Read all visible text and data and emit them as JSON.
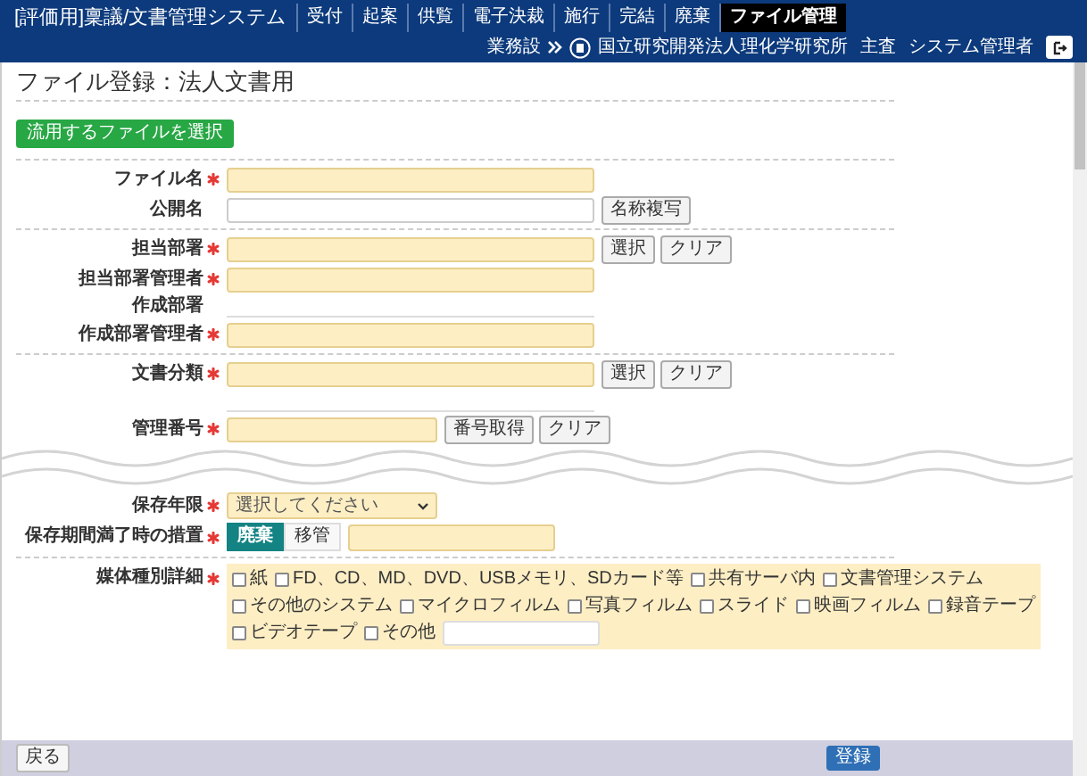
{
  "header": {
    "title": "[評価用]稟議/文書管理システム",
    "nav": [
      {
        "label": "受付",
        "selected": false
      },
      {
        "label": "起案",
        "selected": false
      },
      {
        "label": "供覧",
        "selected": false
      },
      {
        "label": "電子決裁",
        "selected": false
      },
      {
        "label": "施行",
        "selected": false
      },
      {
        "label": "完結",
        "selected": false
      },
      {
        "label": "廃棄",
        "selected": false
      },
      {
        "label": "ファイル管理",
        "selected": true
      }
    ],
    "menu_label": "業務設",
    "organization": "国立研究開発法人理化学研究所",
    "role": "主査",
    "user": "システム管理者"
  },
  "page_title": "ファイル登録：法人文書用",
  "template_button": "流用するファイルを選択",
  "sections": [
    {
      "cut_before": false,
      "fields": [
        {
          "kind": "text",
          "label": "ファイル名",
          "required": true
        },
        {
          "kind": "text",
          "label": "公開名",
          "required": false,
          "buttons": [
            "名称複写"
          ]
        }
      ]
    },
    {
      "cut_before": false,
      "fields": [
        {
          "kind": "text",
          "label": "担当部署",
          "required": true,
          "buttons": [
            "選択",
            "クリア"
          ]
        },
        {
          "kind": "text",
          "label": "担当部署管理者",
          "required": true
        },
        {
          "kind": "static",
          "label": "作成部署"
        },
        {
          "kind": "text",
          "label": "作成部署管理者",
          "required": true
        }
      ]
    },
    {
      "cut_before": false,
      "fields": [
        {
          "kind": "text",
          "label": "文書分類",
          "required": true,
          "buttons": [
            "選択",
            "クリア"
          ]
        },
        {
          "kind": "static"
        },
        {
          "kind": "text",
          "label": "管理番号",
          "required": true,
          "short": true,
          "buttons": [
            "番号取得",
            "クリア"
          ]
        }
      ]
    },
    {
      "cut_before": true,
      "fields": [
        {
          "kind": "select",
          "label": "保存年限",
          "required": true,
          "value": "選択してください"
        },
        {
          "kind": "toggle",
          "label": "保存期間満了時の措置",
          "required": true,
          "options": [
            {
              "label": "廃棄",
              "selected": true
            },
            {
              "label": "移管",
              "selected": false
            }
          ]
        }
      ]
    },
    {
      "cut_before": false,
      "fields": [
        {
          "kind": "checkboxes",
          "label": "媒体種別詳細",
          "required": true,
          "options": [
            {
              "label": "紙",
              "checked": false,
              "kind": "plain"
            },
            {
              "label": "FD、CD、MD、DVD、USBメモリ、SDカード等",
              "checked": false,
              "kind": "plain"
            },
            {
              "label": "共有サーバ内",
              "checked": false,
              "kind": "plain"
            },
            {
              "label": "文書管理システム",
              "checked": false,
              "kind": "plain"
            },
            {
              "label": "その他のシステム",
              "checked": false,
              "kind": "plain"
            },
            {
              "label": "マイクロフィルム",
              "checked": false,
              "kind": "plain"
            },
            {
              "label": "写真フィルム",
              "checked": false,
              "kind": "plain"
            },
            {
              "label": "スライド",
              "checked": false,
              "kind": "plain"
            },
            {
              "label": "映画フィルム",
              "checked": false,
              "kind": "plain"
            },
            {
              "label": "録音テープ",
              "checked": false,
              "kind": "plain"
            },
            {
              "label": "ビデオテープ",
              "checked": false,
              "kind": "plain"
            },
            {
              "label": "その他",
              "checked": false,
              "kind": "with_input"
            }
          ]
        }
      ]
    }
  ],
  "footer": {
    "back": "戻る",
    "submit": "登録"
  }
}
